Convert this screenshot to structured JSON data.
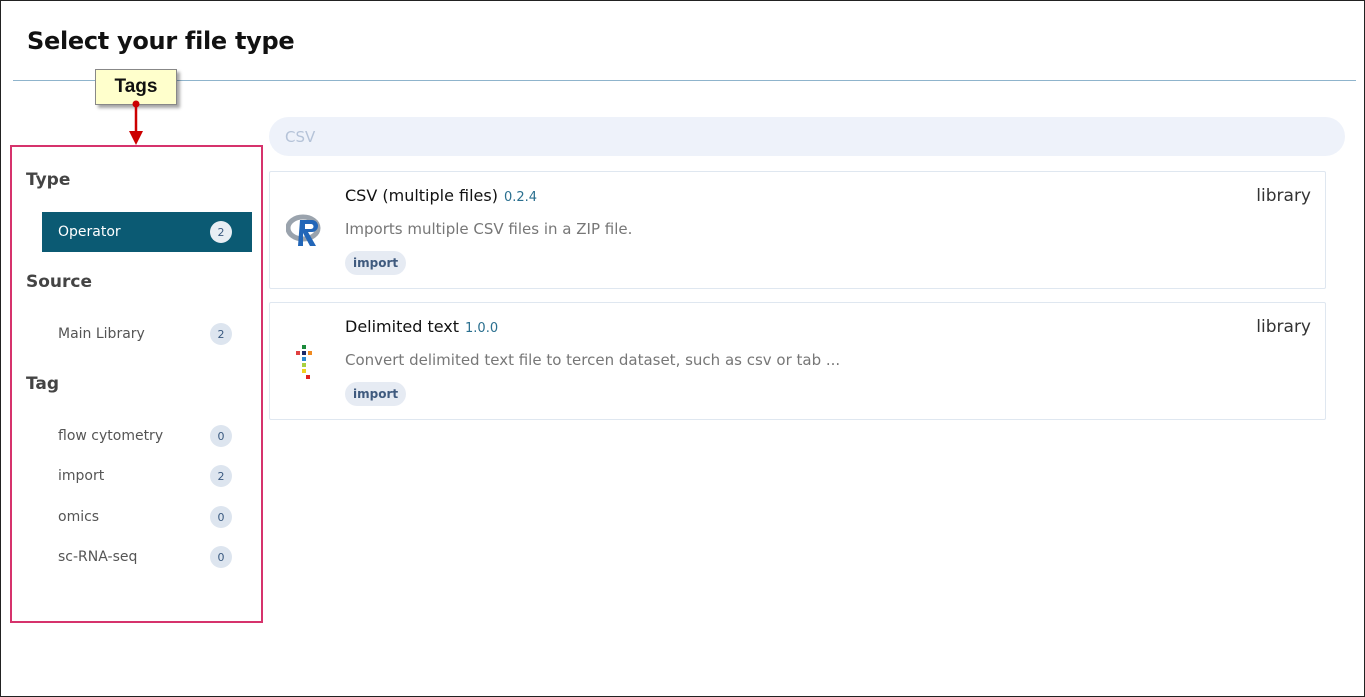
{
  "page": {
    "title": "Select your file type"
  },
  "callout": {
    "label": "Tags"
  },
  "filters": {
    "type": {
      "title": "Type",
      "items": [
        {
          "label": "Operator",
          "count": "2"
        }
      ]
    },
    "source": {
      "title": "Source",
      "items": [
        {
          "label": "Main Library",
          "count": "2"
        }
      ]
    },
    "tag": {
      "title": "Tag",
      "items": [
        {
          "label": "flow cytometry",
          "count": "0"
        },
        {
          "label": "import",
          "count": "2"
        },
        {
          "label": "omics",
          "count": "0"
        },
        {
          "label": "sc-RNA-seq",
          "count": "0"
        }
      ]
    }
  },
  "search": {
    "value": "",
    "placeholder": "CSV"
  },
  "results": [
    {
      "icon": "r-logo-icon",
      "title": "CSV (multiple files)",
      "version": "0.2.4",
      "source": "library",
      "description": "Imports multiple CSV files in a ZIP file.",
      "tag": "import"
    },
    {
      "icon": "tercen-logo-icon",
      "title": "Delimited text",
      "version": "1.0.0",
      "source": "library",
      "description": "Convert delimited text file to tercen dataset, such as csv or tab ...",
      "tag": "import"
    }
  ],
  "colors": {
    "accent": "#0b5a73",
    "callout_border": "#d6336c",
    "callout_fill": "#ffffcc",
    "arrow": "#cc0000"
  }
}
